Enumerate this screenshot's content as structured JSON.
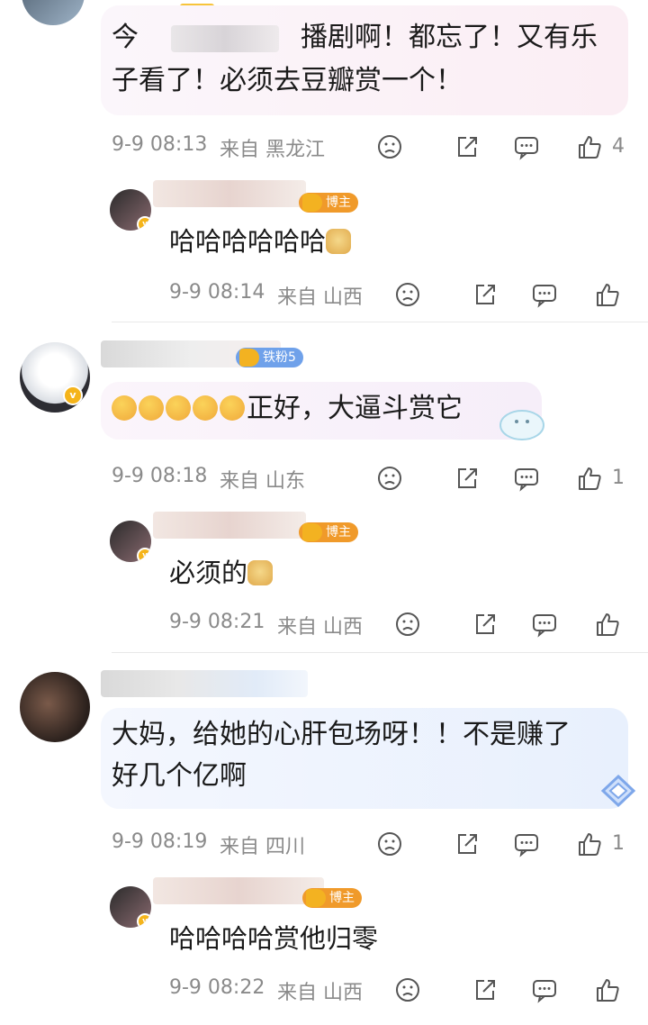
{
  "comments": [
    {
      "text": "今天的直播剧啊！都忘了！又有乐子看了！必须去豆瓣赏一个！",
      "line1": "今",
      "line1b": "播剧啊！都忘了！又有乐",
      "line2": "子看了！必须去豆瓣赏一个！",
      "time": "9-9 08:13",
      "location": "来自 黑龙江",
      "likes": "4",
      "reply": {
        "tag": "博主",
        "text": "哈哈哈哈哈哈",
        "time": "9-9 08:14",
        "location": "来自 山西"
      }
    },
    {
      "tag": "铁粉5",
      "text": "正好，大逼斗赏它",
      "time": "9-9 08:18",
      "location": "来自 山东",
      "likes": "1",
      "reply": {
        "tag": "博主",
        "text": "必须的",
        "time": "9-9 08:21",
        "location": "来自 山西"
      }
    },
    {
      "line1": "大妈，给她的心肝包场呀！！不是赚了",
      "line2": "好几个亿啊",
      "time": "9-9 08:19",
      "location": "来自 四川",
      "likes": "1",
      "reply": {
        "tag": "博主",
        "text": "哈哈哈哈赏他归零",
        "time": "9-9 08:22",
        "location": "来自 山西"
      }
    }
  ],
  "icons": [
    "dislike-icon",
    "share-icon",
    "comment-icon",
    "like-icon",
    "avatar-verified-badge"
  ],
  "colors": {
    "text": "#1a1a1a",
    "meta": "#8a8a8a",
    "host_tag": "#f09a2a",
    "fan_tag": "#6fa1ea"
  }
}
